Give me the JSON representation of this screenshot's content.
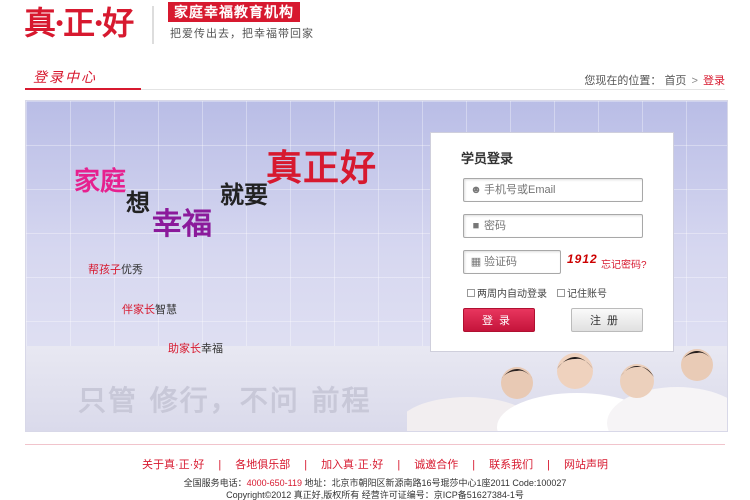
{
  "header": {
    "logo_text": "真·正·好",
    "brand_tag": "家庭幸福教育机构",
    "slogan": "把爱传出去，把幸福带回家"
  },
  "titlebar": {
    "section": "登录中心",
    "crumb_prefix": "您现在的位置：",
    "crumb_home": "首页",
    "crumb_sep": ">",
    "crumb_current": "登录"
  },
  "banner": {
    "word_family": "家庭",
    "word_want": "想",
    "word_happy": "幸福",
    "word_just": "就要",
    "word_zzh": "真正好",
    "tags": [
      {
        "highlight": "帮孩子",
        "rest": "优秀"
      },
      {
        "highlight": "伴家长",
        "rest": "智慧"
      },
      {
        "highlight": "助家长",
        "rest": "幸福"
      }
    ],
    "motto": "只管 修行，不问 前程"
  },
  "login": {
    "title": "学员登录",
    "user_placeholder": "手机号或Email",
    "pass_placeholder": "密码",
    "code_placeholder": "验证码",
    "captcha": "1912",
    "forgot": "忘记密码?",
    "remember_two_weeks": "两周内自动登录",
    "remember_account": "记住账号",
    "login_button": "登录",
    "register_button": "注册"
  },
  "footer": {
    "nav": [
      "关于真·正·好",
      "各地俱乐部",
      "加入真·正·好",
      "诚邀合作",
      "联系我们",
      "网站声明"
    ],
    "nav_sep": "|",
    "service_label": "全国服务电话：",
    "phone": "4000-650-119",
    "address": "地址：北京市朝阳区新源南路16号琨莎中心1座2011 Code:100027",
    "copyright": "Copyright©2012 真正好,版权所有 经营许可证编号：京ICP备51627384-1号"
  },
  "colors": {
    "brand_red": "#d7192f",
    "magenta": "#e6218f",
    "purple": "#8b1a9b"
  }
}
